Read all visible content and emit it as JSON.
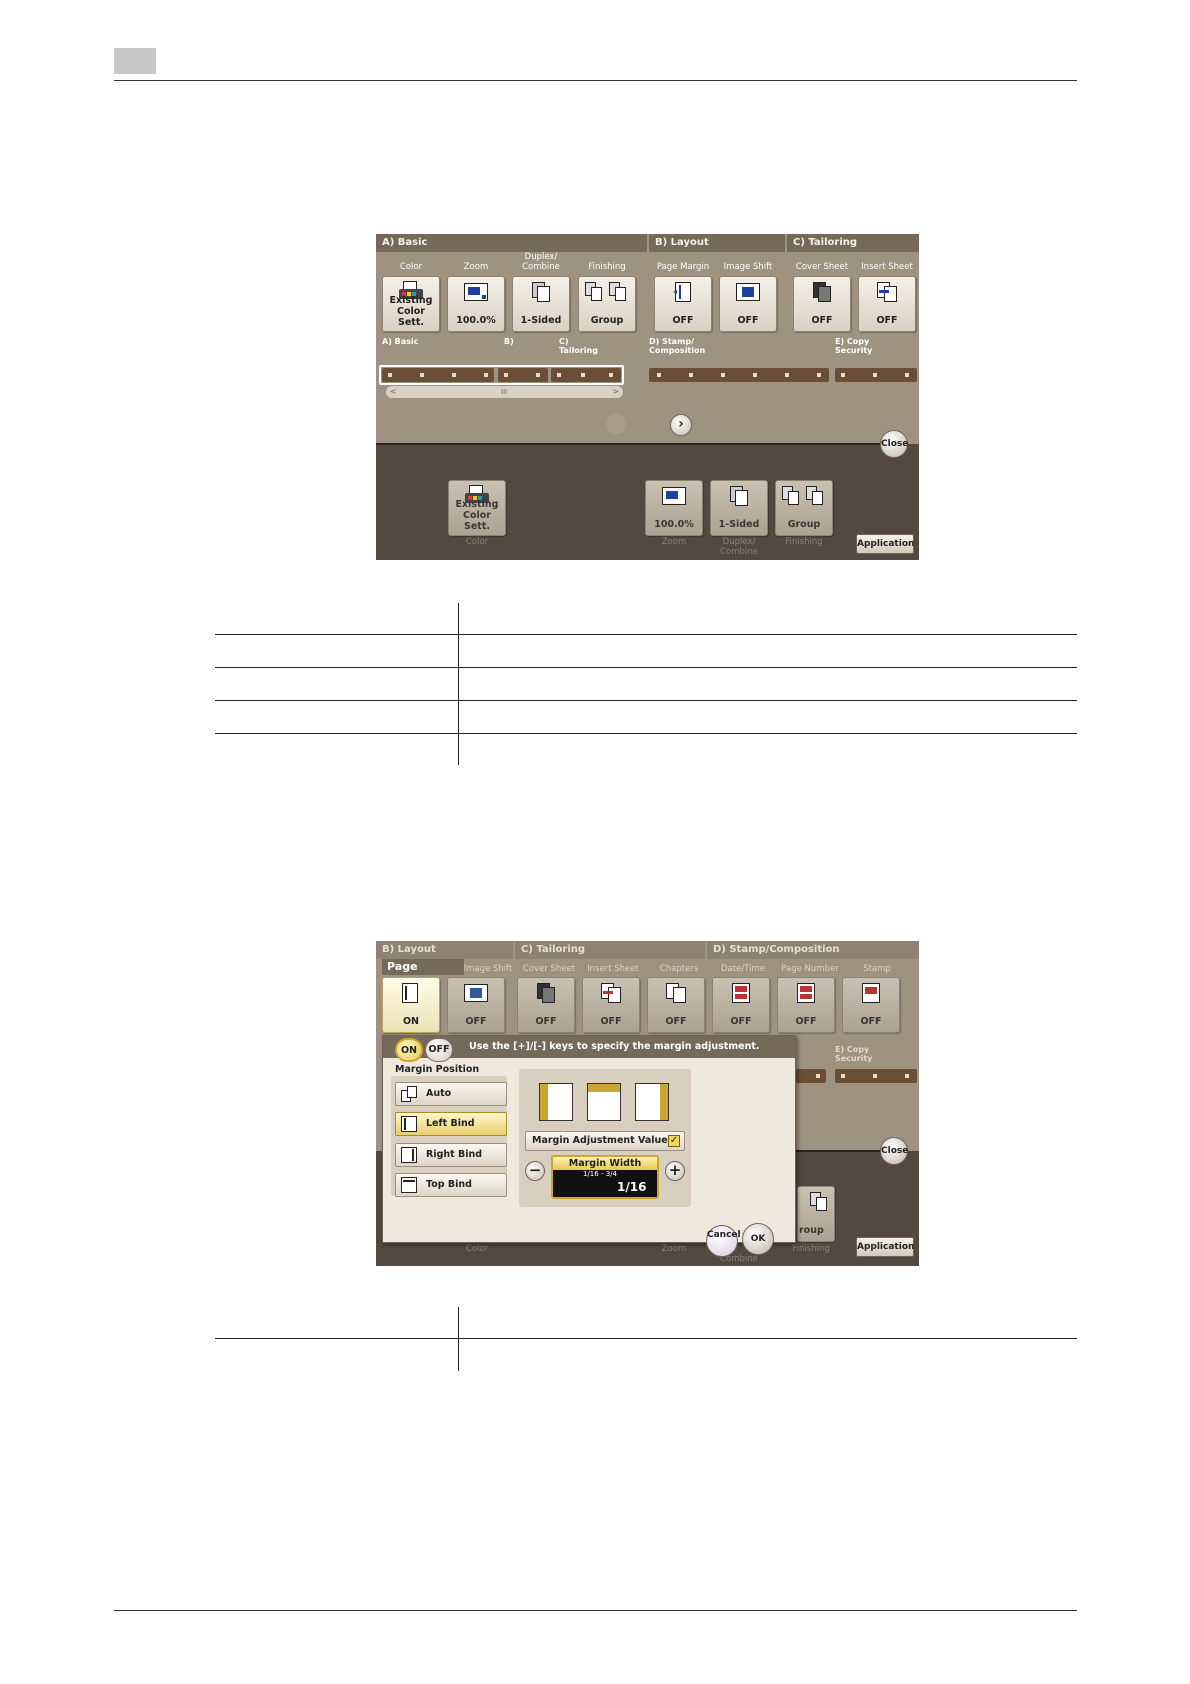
{
  "panel1": {
    "sections": {
      "basic": "A)   Basic",
      "layout": "B)   Layout",
      "tailoring": "C)   Tailoring"
    },
    "columns": {
      "color": "Color",
      "zoom": "Zoom",
      "duplex_combine": "Duplex/ Combine",
      "finishing": "Finishing",
      "page_margin": "Page Margin",
      "image_shift": "Image Shift",
      "cover_sheet": "Cover Sheet",
      "insert_sheet": "Insert Sheet"
    },
    "tiles": {
      "color": "Existing Color Sett.",
      "zoom": "100.0%",
      "duplex": "1-Sided",
      "finishing": "Group",
      "page_margin": "OFF",
      "image_shift": "OFF",
      "cover_sheet": "OFF",
      "insert_sheet": "OFF"
    },
    "nav": {
      "a": "A) Basic",
      "b": "B)",
      "c": "C) Tailoring",
      "d": "D) Stamp/ Composition",
      "e": "E) Copy Security",
      "scroll_left": "<",
      "scroll_mid": "III",
      "scroll_right": ">"
    },
    "close_label": "Close",
    "application_label": "Application",
    "bottom_tiles": {
      "color": "Existing Color Sett.",
      "zoom": "100.0%",
      "duplex": "1-Sided",
      "finishing": "Group"
    },
    "bottom_captions": {
      "color": "Color",
      "zoom": "Zoom",
      "duplex": "Duplex/ Combine",
      "finishing": "Finishing"
    }
  },
  "panel2": {
    "sections": {
      "layout": "B)   Layout",
      "tailoring": "C)   Tailoring",
      "stamp": "D)   Stamp/Composition"
    },
    "active_title": "Page Margin",
    "columns": {
      "image_shift": "Image Shift",
      "cover_sheet": "Cover Sheet",
      "insert_sheet": "Insert Sheet",
      "chapters": "Chapters",
      "date_time": "Date/Time",
      "page_number": "Page Number",
      "stamp": "Stamp"
    },
    "tiles": {
      "page_margin": "ON",
      "image_shift": "OFF",
      "cover_sheet": "OFF",
      "insert_sheet": "OFF",
      "chapters": "OFF",
      "date_time": "OFF",
      "page_number": "OFF",
      "stamp": "OFF"
    },
    "dialog": {
      "on": "ON",
      "off": "OFF",
      "instruction": "Use the [+]/[-] keys to specify the margin adjustment.",
      "margin_position": "Margin Position",
      "positions": [
        "Auto",
        "Left Bind",
        "Right Bind",
        "Top Bind"
      ],
      "margin_adjustment_value": "Margin Adjustment Value",
      "margin_width": "Margin Width",
      "range_text": "1/16  -  3/4",
      "value_text": "1/16",
      "minus": "−",
      "plus": "+"
    },
    "right_nav_e": "E) Copy Security",
    "close_label": "Close",
    "application_label": "Application",
    "cancel_label": "Cancel",
    "ok_label": "OK",
    "group_partial": "roup",
    "bottom_captions": {
      "color": "Color",
      "zoom": "Zoom",
      "combine": "Combine",
      "finishing": "Finishing"
    }
  },
  "colors": {
    "panel_bg": "#9e9280",
    "dark_area": "#524a40",
    "accent_gold": "#e9cf6a",
    "icon_blue": "#1d3fa1"
  }
}
